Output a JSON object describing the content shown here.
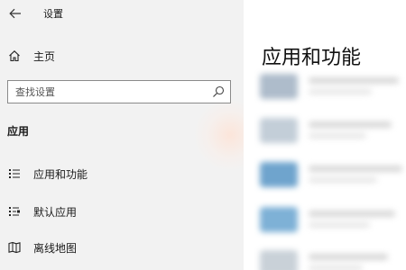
{
  "window": {
    "title": "设置",
    "back_icon": "arrow-left-icon"
  },
  "sidebar": {
    "home": {
      "label": "主页",
      "icon": "home-icon"
    },
    "search": {
      "placeholder": "查找设置",
      "value": "",
      "icon": "search-icon"
    },
    "section_heading": "应用",
    "items": [
      {
        "label": "应用和功能",
        "icon": "apps-features-icon"
      },
      {
        "label": "默认应用",
        "icon": "default-apps-icon"
      },
      {
        "label": "离线地图",
        "icon": "offline-maps-icon"
      }
    ]
  },
  "main": {
    "page_title": "应用和功能",
    "app_tile_colors": [
      "#aebccb",
      "#c3ced8",
      "#6fa4cd",
      "#7eb1d6",
      "#c9d1d8"
    ]
  }
}
